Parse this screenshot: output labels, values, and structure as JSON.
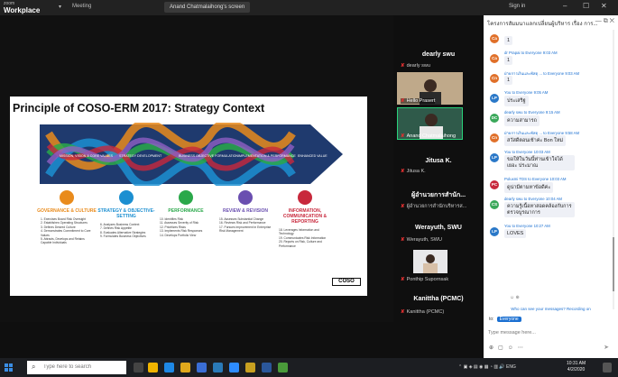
{
  "titlebar": {
    "app_line1": "zoom",
    "app_line2": "Workplace",
    "meeting": "Meeting",
    "share_label": "Anand Chatmalaihong's screen",
    "signin": "Sign in"
  },
  "slide": {
    "title": "Principle of COSO-ERM 2017: Strategy Context",
    "helix_labels": [
      "MISSION, VISION & CORE VALUES",
      "STRATEGY DEVELOPMENT",
      "BUSINESS OBJECTIVE FORMULATION",
      "IMPLEMENTATION & PERFORMANCE",
      "ENHANCED VALUE"
    ],
    "columns": [
      {
        "title": "GOVERNANCE & CULTURE",
        "color": "#e98b1c",
        "items": [
          "1. Exercises Board Risk Oversight",
          "2. Establishes Operating Structures",
          "3. Defines Desired Culture",
          "4. Demonstrates Commitment to Core Values",
          "5. Attracts, Develops and Retains Capable Individuals"
        ]
      },
      {
        "title": "STRATEGY & OBJECTIVE-SETTING",
        "color": "#1c8fd1",
        "items": [
          "6. Analyzes Business Context",
          "7. Defines Risk Appetite",
          "8. Evaluates Alternative Strategies",
          "9. Formulates Business Objectives"
        ]
      },
      {
        "title": "PERFORMANCE",
        "color": "#2aa84a",
        "items": [
          "10. Identifies Risk",
          "11. Assesses Severity of Risk",
          "12. Prioritizes Risks",
          "13. Implements Risk Responses",
          "14. Develops Portfolio View"
        ]
      },
      {
        "title": "REVIEW & REVISION",
        "color": "#6a4fb0",
        "items": [
          "15. Assesses Substantial Change",
          "16. Reviews Risk and Performance",
          "17. Pursues Improvement in Enterprise Risk Management"
        ]
      },
      {
        "title": "INFORMATION, COMMUNICATION & REPORTING",
        "color": "#c8283c",
        "items": [
          "18. Leverages Information and Technology",
          "19. Communicates Risk Information",
          "20. Reports on Risk, Culture and Performance"
        ]
      }
    ],
    "logo_text": "COSO"
  },
  "participants": [
    {
      "name": "dearly swu",
      "sub": "dearly swu"
    },
    {
      "name": "",
      "sub": "Hello Prasert"
    },
    {
      "name": "",
      "sub": "Anand Chatmalaihong"
    },
    {
      "name": "Jitusa K.",
      "sub": "Jitusa K."
    },
    {
      "name": "ผู้อำนวยการสำนัก...",
      "sub": "ผู้อำนวยการสำนักบริหารส..."
    },
    {
      "name": "Werayuth, SWU",
      "sub": "Werayuth, SWU"
    },
    {
      "name": "",
      "sub": "Ponthip Supornsak"
    },
    {
      "name": "Kanittha (PCMC)",
      "sub": "Kanittha (PCMC)"
    }
  ],
  "chat": {
    "header": "โครงการสัมมนาแลกเปลี่ยนผู้บริหาร เรื่อง การ...",
    "messages": [
      {
        "av": "Ca",
        "avcolor": "#e0702a",
        "meta": "",
        "body": "1"
      },
      {
        "av": "Ca",
        "avcolor": "#e0702a",
        "meta": "dr Prapai to Everyone 9:03 AM",
        "body": "1"
      },
      {
        "av": "Cn",
        "avcolor": "#e0702a",
        "meta": "ฝ่ายการเงินและพัสดุ ... to Everyone 9:03 AM",
        "body": "1"
      },
      {
        "av": "LP",
        "avcolor": "#2a78c8",
        "meta": "You to Everyone 9:05 AM",
        "body": "ประเสริฐ"
      },
      {
        "av": "DC",
        "avcolor": "#3aa85a",
        "meta": "dearly swu to Everyone 9:15 AM",
        "body": "ความสามารถ"
      },
      {
        "av": "Cn",
        "avcolor": "#e0702a",
        "meta": "ฝ่ายการเงินและพัสดุ ... to Everyone 9:58 AM",
        "body": "สวัสดีตอนเช้าค่ะ Bon ใหม่"
      },
      {
        "av": "LP",
        "avcolor": "#2a78c8",
        "meta": "You to Everyone 10:03 AM",
        "body": "ขอให้ในวันนี้ท่านเข้าใจได้เยอะ ประมาณ",
        "tall": true
      },
      {
        "av": "PC",
        "avcolor": "#c8283c",
        "meta": "Poluxmi TDS to Everyone 10:03 AM",
        "body": "ดูน่ามีตามหาข้อดีค่ะ"
      },
      {
        "av": "CS",
        "avcolor": "#3aa85a",
        "meta": "dearly swu to Everyone 10:04 AM",
        "body": "ความรู้เนื้อหาสอดคล้องกับการตรวจบูรณาการ",
        "tall": true
      },
      {
        "av": "LP",
        "avcolor": "#2a78c8",
        "meta": "You to Everyone 10:27 AM",
        "body": "LOVES"
      }
    ],
    "reactions": "☺ ⊕",
    "who_can_see": "Who can see your messages? Recording on",
    "to_label": "to:",
    "to_value": "Everyone",
    "input_placeholder": "Type message here..."
  },
  "taskbar": {
    "search_placeholder": "Type here to search",
    "time": "10:31 AM",
    "date": "4/2/2020"
  }
}
